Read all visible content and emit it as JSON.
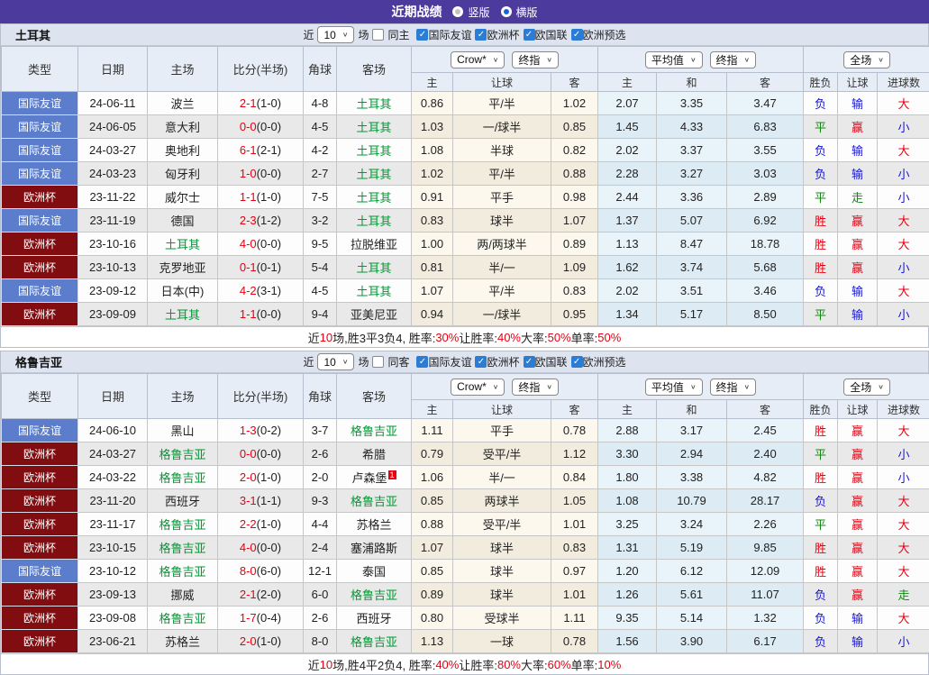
{
  "title_bar": {
    "title": "近期战绩",
    "options": [
      {
        "label": "竖版",
        "selected": false
      },
      {
        "label": "横版",
        "selected": true
      }
    ]
  },
  "columns": {
    "main": [
      "类型",
      "日期",
      "主场",
      "比分(半场)",
      "角球",
      "客场"
    ],
    "sub": [
      "主",
      "让球",
      "客",
      "主",
      "和",
      "客",
      "胜负",
      "让球",
      "进球数"
    ]
  },
  "header_controls": {
    "crow": "Crow*",
    "final1": "终指",
    "avg": "平均值",
    "final2": "终指",
    "full": "全场"
  },
  "tables": [
    {
      "team": "土耳其",
      "filter": {
        "recent_label": "近",
        "recent_value": "10",
        "games_label": "场",
        "same_label": "同主",
        "same_checked": false,
        "leagues": [
          {
            "label": "国际友谊",
            "checked": true
          },
          {
            "label": "欧洲杯",
            "checked": true
          },
          {
            "label": "欧国联",
            "checked": true
          },
          {
            "label": "欧洲预选",
            "checked": true
          }
        ]
      },
      "rows": [
        {
          "type": "国际友谊",
          "date": "24-06-11",
          "home": "波兰",
          "score": "2-1",
          "half": "(1-0)",
          "corner": "4-8",
          "away": "土耳其",
          "c_home": "0.86",
          "c_hcp": "平/半",
          "c_away": "1.02",
          "a_home": "2.07",
          "a_draw": "3.35",
          "a_away": "3.47",
          "r_wdl": "负",
          "r_hcp": "输",
          "r_goal": "大"
        },
        {
          "type": "国际友谊",
          "date": "24-06-05",
          "home": "意大利",
          "score": "0-0",
          "half": "(0-0)",
          "corner": "4-5",
          "away": "土耳其",
          "c_home": "1.03",
          "c_hcp": "一/球半",
          "c_away": "0.85",
          "a_home": "1.45",
          "a_draw": "4.33",
          "a_away": "6.83",
          "r_wdl": "平",
          "r_hcp": "赢",
          "r_goal": "小"
        },
        {
          "type": "国际友谊",
          "date": "24-03-27",
          "home": "奥地利",
          "score": "6-1",
          "half": "(2-1)",
          "corner": "4-2",
          "away": "土耳其",
          "c_home": "1.08",
          "c_hcp": "半球",
          "c_away": "0.82",
          "a_home": "2.02",
          "a_draw": "3.37",
          "a_away": "3.55",
          "r_wdl": "负",
          "r_hcp": "输",
          "r_goal": "大"
        },
        {
          "type": "国际友谊",
          "date": "24-03-23",
          "home": "匈牙利",
          "score": "1-0",
          "half": "(0-0)",
          "corner": "2-7",
          "away": "土耳其",
          "c_home": "1.02",
          "c_hcp": "平/半",
          "c_away": "0.88",
          "a_home": "2.28",
          "a_draw": "3.27",
          "a_away": "3.03",
          "r_wdl": "负",
          "r_hcp": "输",
          "r_goal": "小"
        },
        {
          "type": "欧洲杯",
          "date": "23-11-22",
          "home": "威尔士",
          "score": "1-1",
          "half": "(1-0)",
          "corner": "7-5",
          "away": "土耳其",
          "c_home": "0.91",
          "c_hcp": "平手",
          "c_away": "0.98",
          "a_home": "2.44",
          "a_draw": "3.36",
          "a_away": "2.89",
          "r_wdl": "平",
          "r_hcp": "走",
          "r_goal": "小"
        },
        {
          "type": "国际友谊",
          "date": "23-11-19",
          "home": "德国",
          "score": "2-3",
          "half": "(1-2)",
          "corner": "3-2",
          "away": "土耳其",
          "c_home": "0.83",
          "c_hcp": "球半",
          "c_away": "1.07",
          "a_home": "1.37",
          "a_draw": "5.07",
          "a_away": "6.92",
          "r_wdl": "胜",
          "r_hcp": "赢",
          "r_goal": "大"
        },
        {
          "type": "欧洲杯",
          "date": "23-10-16",
          "home": "土耳其",
          "score": "4-0",
          "half": "(0-0)",
          "corner": "9-5",
          "away": "拉脱维亚",
          "c_home": "1.00",
          "c_hcp": "两/两球半",
          "c_away": "0.89",
          "a_home": "1.13",
          "a_draw": "8.47",
          "a_away": "18.78",
          "r_wdl": "胜",
          "r_hcp": "赢",
          "r_goal": "大"
        },
        {
          "type": "欧洲杯",
          "date": "23-10-13",
          "home": "克罗地亚",
          "score": "0-1",
          "half": "(0-1)",
          "corner": "5-4",
          "away": "土耳其",
          "c_home": "0.81",
          "c_hcp": "半/一",
          "c_away": "1.09",
          "a_home": "1.62",
          "a_draw": "3.74",
          "a_away": "5.68",
          "r_wdl": "胜",
          "r_hcp": "赢",
          "r_goal": "小"
        },
        {
          "type": "国际友谊",
          "date": "23-09-12",
          "home": "日本(中)",
          "score": "4-2",
          "half": "(3-1)",
          "corner": "4-5",
          "away": "土耳其",
          "c_home": "1.07",
          "c_hcp": "平/半",
          "c_away": "0.83",
          "a_home": "2.02",
          "a_draw": "3.51",
          "a_away": "3.46",
          "r_wdl": "负",
          "r_hcp": "输",
          "r_goal": "大"
        },
        {
          "type": "欧洲杯",
          "date": "23-09-09",
          "home": "土耳其",
          "score": "1-1",
          "half": "(0-0)",
          "corner": "9-4",
          "away": "亚美尼亚",
          "c_home": "0.94",
          "c_hcp": "一/球半",
          "c_away": "0.95",
          "a_home": "1.34",
          "a_draw": "5.17",
          "a_away": "8.50",
          "r_wdl": "平",
          "r_hcp": "输",
          "r_goal": "小"
        }
      ],
      "summary": [
        {
          "text": "近",
          "red": false
        },
        {
          "text": "10",
          "red": true
        },
        {
          "text": "场,胜3平3负4, 胜率:",
          "red": false
        },
        {
          "text": "30%",
          "red": true
        },
        {
          "text": " 让胜率:",
          "red": false
        },
        {
          "text": "40%",
          "red": true
        },
        {
          "text": " 大率:",
          "red": false
        },
        {
          "text": "50%",
          "red": true
        },
        {
          "text": " 单率:",
          "red": false
        },
        {
          "text": "50%",
          "red": true
        }
      ]
    },
    {
      "team": "格鲁吉亚",
      "filter": {
        "recent_label": "近",
        "recent_value": "10",
        "games_label": "场",
        "same_label": "同客",
        "same_checked": false,
        "leagues": [
          {
            "label": "国际友谊",
            "checked": true
          },
          {
            "label": "欧洲杯",
            "checked": true
          },
          {
            "label": "欧国联",
            "checked": true
          },
          {
            "label": "欧洲预选",
            "checked": true
          }
        ]
      },
      "rows": [
        {
          "type": "国际友谊",
          "date": "24-06-10",
          "home": "黑山",
          "score": "1-3",
          "half": "(0-2)",
          "corner": "3-7",
          "away": "格鲁吉亚",
          "c_home": "1.11",
          "c_hcp": "平手",
          "c_away": "0.78",
          "a_home": "2.88",
          "a_draw": "3.17",
          "a_away": "2.45",
          "r_wdl": "胜",
          "r_hcp": "赢",
          "r_goal": "大"
        },
        {
          "type": "欧洲杯",
          "date": "24-03-27",
          "home": "格鲁吉亚",
          "score": "0-0",
          "half": "(0-0)",
          "corner": "2-6",
          "away": "希腊",
          "c_home": "0.79",
          "c_hcp": "受平/半",
          "c_away": "1.12",
          "a_home": "3.30",
          "a_draw": "2.94",
          "a_away": "2.40",
          "r_wdl": "平",
          "r_hcp": "赢",
          "r_goal": "小"
        },
        {
          "type": "欧洲杯",
          "date": "24-03-22",
          "home": "格鲁吉亚",
          "score": "2-0",
          "half": "(1-0)",
          "corner": "2-0",
          "away": "卢森堡",
          "away_sup": "1",
          "c_home": "1.06",
          "c_hcp": "半/一",
          "c_away": "0.84",
          "a_home": "1.80",
          "a_draw": "3.38",
          "a_away": "4.82",
          "r_wdl": "胜",
          "r_hcp": "赢",
          "r_goal": "小"
        },
        {
          "type": "欧洲杯",
          "date": "23-11-20",
          "home": "西班牙",
          "score": "3-1",
          "half": "(1-1)",
          "corner": "9-3",
          "away": "格鲁吉亚",
          "c_home": "0.85",
          "c_hcp": "两球半",
          "c_away": "1.05",
          "a_home": "1.08",
          "a_draw": "10.79",
          "a_away": "28.17",
          "r_wdl": "负",
          "r_hcp": "赢",
          "r_goal": "大"
        },
        {
          "type": "欧洲杯",
          "date": "23-11-17",
          "home": "格鲁吉亚",
          "score": "2-2",
          "half": "(1-0)",
          "corner": "4-4",
          "away": "苏格兰",
          "c_home": "0.88",
          "c_hcp": "受平/半",
          "c_away": "1.01",
          "a_home": "3.25",
          "a_draw": "3.24",
          "a_away": "2.26",
          "r_wdl": "平",
          "r_hcp": "赢",
          "r_goal": "大"
        },
        {
          "type": "欧洲杯",
          "date": "23-10-15",
          "home": "格鲁吉亚",
          "score": "4-0",
          "half": "(0-0)",
          "corner": "2-4",
          "away": "塞浦路斯",
          "c_home": "1.07",
          "c_hcp": "球半",
          "c_away": "0.83",
          "a_home": "1.31",
          "a_draw": "5.19",
          "a_away": "9.85",
          "r_wdl": "胜",
          "r_hcp": "赢",
          "r_goal": "大"
        },
        {
          "type": "国际友谊",
          "date": "23-10-12",
          "home": "格鲁吉亚",
          "score": "8-0",
          "half": "(6-0)",
          "corner": "12-1",
          "away": "泰国",
          "c_home": "0.85",
          "c_hcp": "球半",
          "c_away": "0.97",
          "a_home": "1.20",
          "a_draw": "6.12",
          "a_away": "12.09",
          "r_wdl": "胜",
          "r_hcp": "赢",
          "r_goal": "大"
        },
        {
          "type": "欧洲杯",
          "date": "23-09-13",
          "home": "挪威",
          "score": "2-1",
          "half": "(2-0)",
          "corner": "6-0",
          "away": "格鲁吉亚",
          "c_home": "0.89",
          "c_hcp": "球半",
          "c_away": "1.01",
          "a_home": "1.26",
          "a_draw": "5.61",
          "a_away": "11.07",
          "r_wdl": "负",
          "r_hcp": "赢",
          "r_goal": "走"
        },
        {
          "type": "欧洲杯",
          "date": "23-09-08",
          "home": "格鲁吉亚",
          "score": "1-7",
          "half": "(0-4)",
          "corner": "2-6",
          "away": "西班牙",
          "c_home": "0.80",
          "c_hcp": "受球半",
          "c_away": "1.11",
          "a_home": "9.35",
          "a_draw": "5.14",
          "a_away": "1.32",
          "r_wdl": "负",
          "r_hcp": "输",
          "r_goal": "大"
        },
        {
          "type": "欧洲杯",
          "date": "23-06-21",
          "home": "苏格兰",
          "score": "2-0",
          "half": "(1-0)",
          "corner": "8-0",
          "away": "格鲁吉亚",
          "c_home": "1.13",
          "c_hcp": "一球",
          "c_away": "0.78",
          "a_home": "1.56",
          "a_draw": "3.90",
          "a_away": "6.17",
          "r_wdl": "负",
          "r_hcp": "输",
          "r_goal": "小"
        }
      ],
      "summary": [
        {
          "text": "近",
          "red": false
        },
        {
          "text": "10",
          "red": true
        },
        {
          "text": "场,胜4平2负4, 胜率:",
          "red": false
        },
        {
          "text": "40%",
          "red": true
        },
        {
          "text": " 让胜率:",
          "red": false
        },
        {
          "text": "80%",
          "red": true
        },
        {
          "text": " 大率:",
          "red": false
        },
        {
          "text": "60%",
          "red": true
        },
        {
          "text": " 单率:",
          "red": false
        },
        {
          "text": "10%",
          "red": true
        }
      ]
    }
  ],
  "colors": {
    "accent_purple": "#4c3a9c",
    "type_friendly_blue": "#5b7dcb",
    "type_euro_maroon": "#820d10",
    "win_red": "#e60012",
    "draw_green": "#0f8a0f",
    "lose_blue": "#1616d1",
    "team_highlight_green": "#009933"
  }
}
